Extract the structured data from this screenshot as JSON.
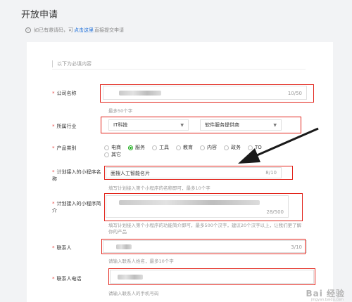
{
  "page": {
    "title": "开放申请",
    "hint_prefix": "如已有邀请码，可",
    "hint_link": "点击这里",
    "hint_suffix": "直接提交申请"
  },
  "form": {
    "section_label": "以下为必填内容",
    "company": {
      "label": "公司名称",
      "counter": "10/50",
      "help": "最多50个字"
    },
    "industry": {
      "label": "所属行业",
      "primary": "IT科技",
      "secondary": "软件服务提供商"
    },
    "category": {
      "label": "产品类别",
      "options": [
        "电商",
        "服务",
        "工具",
        "教育",
        "内容",
        "政务",
        "TO",
        "其它"
      ],
      "selected": "服务"
    },
    "miniapp_name": {
      "label": "计划接入的小程序名称",
      "value": "面搜人工智能名片",
      "counter": "8/10",
      "help": "填写计划接入第个小程序的名称即可，最多10个字"
    },
    "miniapp_intro": {
      "label": "计划接入的小程序简介",
      "counter": "28/500",
      "help": "填写计划接入第个小程序的功能简介即可，最多500个汉字，建议20个汉字以上，让我们更了解你的产品"
    },
    "contact": {
      "label": "联系人",
      "counter": "3/10",
      "help": "请输入联系人姓名，最多10个字"
    },
    "phone": {
      "label": "联系人电话",
      "help": "请输入联系人的手机号码"
    }
  },
  "watermark": {
    "brand": "Bai 经验",
    "sub": "jingyan.baidu.com"
  },
  "colors": {
    "accent_green": "#1aad19",
    "link_blue": "#1e6fd9",
    "annotation_red": "#e2231a"
  }
}
